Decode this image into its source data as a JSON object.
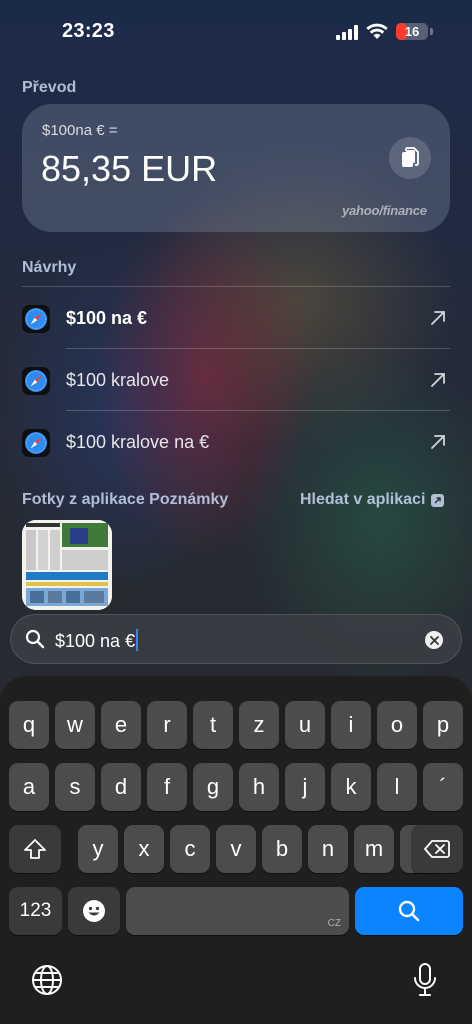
{
  "status_bar": {
    "time": "23:23",
    "battery": "16",
    "battery_level": 0.16
  },
  "conversion": {
    "section_label": "Převod",
    "query": "$100na € =",
    "result": "85,35 EUR",
    "source": "yahoo/finance"
  },
  "suggestions": {
    "section_label": "Návrhy",
    "items": [
      {
        "label": "$100 na €",
        "bold": true,
        "icon": "safari-icon"
      },
      {
        "label": "$100 kralove",
        "bold": false,
        "icon": "safari-icon"
      },
      {
        "label": "$100 kralove na €",
        "bold": false,
        "icon": "safari-icon"
      }
    ]
  },
  "notes": {
    "section_label": "Fotky z aplikace Poznámky",
    "search_in_app": "Hledat v aplikaci"
  },
  "search": {
    "query": "$100 na €"
  },
  "keyboard": {
    "row1": [
      "q",
      "w",
      "e",
      "r",
      "t",
      "z",
      "u",
      "i",
      "o",
      "p"
    ],
    "row2": [
      "a",
      "s",
      "d",
      "f",
      "g",
      "h",
      "j",
      "k",
      "l",
      "´"
    ],
    "row3": [
      "y",
      "x",
      "c",
      "v",
      "b",
      "n",
      "m",
      "ˇ"
    ],
    "numbers_key": "123",
    "space_lang": "CZ"
  },
  "colors": {
    "accent": "#0a84ff",
    "battery_low": "#ff3b30"
  }
}
